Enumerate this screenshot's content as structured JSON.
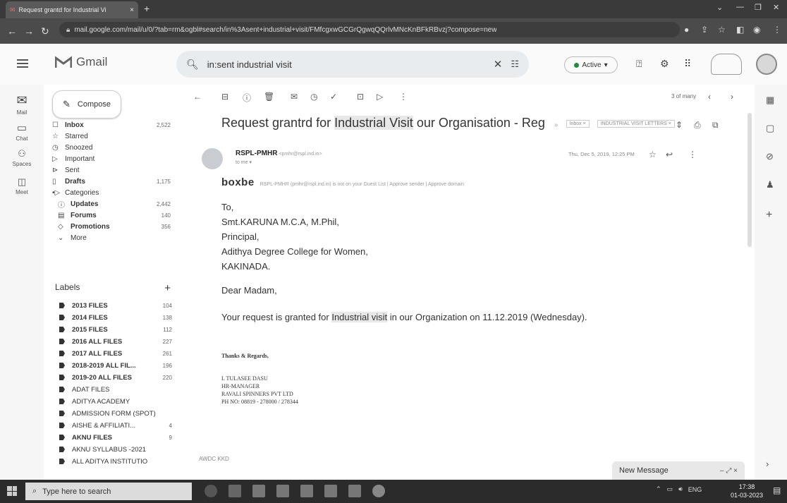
{
  "browser": {
    "tab_title": "Request grantd for Industrial Vi",
    "tab_close": "×",
    "new_tab": "+",
    "url": "mail.google.com/mail/u/0/?tab=rm&ogbl#search/in%3Asent+industrial+visit/FMfcgxwGCGrQgwqQQrlvMNcKnBFkRBvzj?compose=new"
  },
  "header": {
    "app_name": "Gmail",
    "search_query": "in:sent industrial visit",
    "status_label": "Active"
  },
  "rail": {
    "items": [
      {
        "label": "Mail"
      },
      {
        "label": "Chat"
      },
      {
        "label": "Spaces"
      },
      {
        "label": "Meet"
      }
    ]
  },
  "sidebar": {
    "compose_label": "Compose",
    "nav": [
      {
        "label": "Inbox",
        "count": "2,522",
        "bold": true
      },
      {
        "label": "Starred",
        "count": ""
      },
      {
        "label": "Snoozed",
        "count": ""
      },
      {
        "label": "Important",
        "count": ""
      },
      {
        "label": "Sent",
        "count": ""
      },
      {
        "label": "Drafts",
        "count": "1,175",
        "bold": true
      },
      {
        "label": "Categories",
        "count": ""
      },
      {
        "label": "Updates",
        "count": "2,442",
        "bold": true
      },
      {
        "label": "Forums",
        "count": "140",
        "bold": true
      },
      {
        "label": "Promotions",
        "count": "356",
        "bold": true
      },
      {
        "label": "More",
        "count": ""
      }
    ],
    "labels_title": "Labels",
    "labels_add": "+",
    "labels": [
      {
        "label": "2013 FILES",
        "count": "104",
        "bold": true
      },
      {
        "label": "2014 FILES",
        "count": "138",
        "bold": true
      },
      {
        "label": "2015 FILES",
        "count": "112",
        "bold": true
      },
      {
        "label": "2016 ALL FILES",
        "count": "227",
        "bold": true
      },
      {
        "label": "2017 ALL FILES",
        "count": "261",
        "bold": true
      },
      {
        "label": "2018-2019 ALL FIL...",
        "count": "196",
        "bold": true
      },
      {
        "label": "2019-20 ALL FILES",
        "count": "220",
        "bold": true
      },
      {
        "label": "ADAT FILES",
        "count": ""
      },
      {
        "label": "ADITYA ACADEMY",
        "count": ""
      },
      {
        "label": "ADMISSION FORM (SPOT)",
        "count": ""
      },
      {
        "label": "AISHE & AFFILIATI...",
        "count": "4"
      },
      {
        "label": "AKNU FILES",
        "count": "9",
        "bold": true
      },
      {
        "label": "AKNU SYLLABUS -2021",
        "count": ""
      },
      {
        "label": "ALL ADITYA INSTITUTIO",
        "count": ""
      }
    ]
  },
  "email": {
    "pager": "3 of many",
    "subject_pre": "Request grantrd for ",
    "subject_hl": "Industrial Visit",
    "subject_post": " our Organisation - Reg",
    "chip_inbox": "Inbox ×",
    "chip_label": "INDUSTRIAL VISIT LETTERS ×",
    "from_name": "RSPL-PMHR",
    "from_email": "<pmhr@rspl.ind.in>",
    "to": "to me ▾",
    "date": "Thu, Dec 5, 2019, 12:25 PM",
    "boxbe_brand": "boxbe",
    "boxbe_msg": "RSPL-PMHR (pmhr@rspl.ind.in) is not on your Guest List | Approve sender | Approve domain",
    "body": {
      "to": "To,",
      "name": "Smt.KARUNA M.C.A, M.Phil,",
      "title": "Principal,",
      "college": "Adithya Degree College for Women,",
      "city": "KAKINADA.",
      "greeting": "Dear Madam,",
      "line_pre": "Your request is granted for ",
      "line_hl": "Industrial visit",
      "line_post": " in our Organization on 11.12.2019 (Wednesday)."
    },
    "signature": {
      "thanks": "Thanks & Regards,",
      "name": "L TULASEE DASU",
      "role": "HR-MANAGER",
      "company": "RAVALI SPINNERS PVT LTD",
      "phone": "PH NO: 08819 - 278000 / 278344"
    },
    "next_sender": "AWDC KKD"
  },
  "compose_bar": {
    "label": "New Message",
    "controls": "– ⤢ ×"
  },
  "taskbar": {
    "search_placeholder": "Type here to search",
    "lang": "ENG",
    "time": "17:38",
    "date": "01-03-2023"
  }
}
